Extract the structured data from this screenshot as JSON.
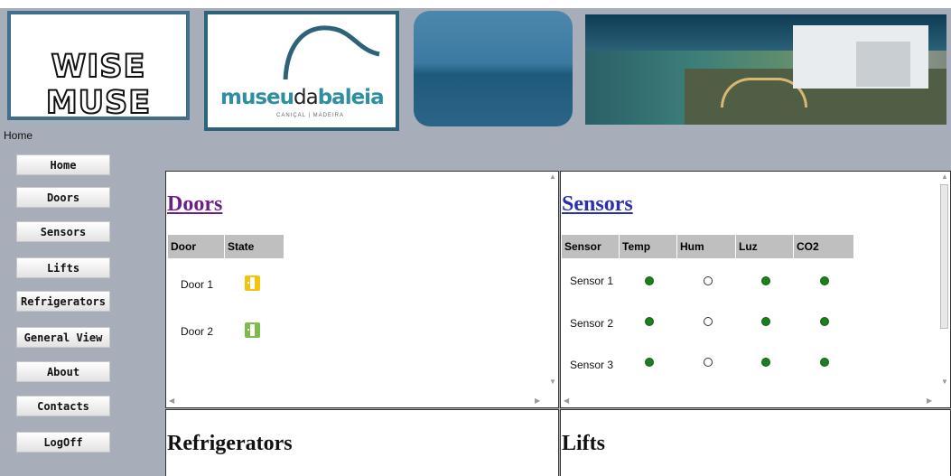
{
  "breadcrumb": "Home",
  "logos": {
    "wise_muse": "WISE MUSE",
    "museum_name_a": "museu",
    "museum_name_b": "da",
    "museum_name_c": "baleia",
    "museum_sub": "CANIÇAL | MADEIRA"
  },
  "nav": [
    {
      "label": "Home"
    },
    {
      "label": "Doors"
    },
    {
      "label": "Sensors"
    },
    {
      "label": "Lifts"
    },
    {
      "label": "Refrigerators"
    },
    {
      "label": "General View"
    },
    {
      "label": "About"
    },
    {
      "label": "Contacts"
    },
    {
      "label": "LogOff"
    }
  ],
  "doors_panel": {
    "title": "Doors",
    "headers": [
      "Door",
      "State"
    ],
    "rows": [
      {
        "name": "Door 1",
        "state_icon": "door-icon-yellow",
        "color": "#f2c40f"
      },
      {
        "name": "Door 2",
        "state_icon": "door-icon-green",
        "color": "#7dbb4a"
      }
    ]
  },
  "sensors_panel": {
    "title": "Sensors",
    "headers": [
      "Sensor",
      "Temp",
      "Hum",
      "Luz",
      "CO2"
    ],
    "rows": [
      {
        "name": "Sensor 1",
        "temp": "on",
        "hum": "off",
        "luz": "on",
        "co2": "on"
      },
      {
        "name": "Sensor 2",
        "temp": "on",
        "hum": "off",
        "luz": "on",
        "co2": "on"
      },
      {
        "name": "Sensor 3",
        "temp": "on",
        "hum": "off",
        "luz": "on",
        "co2": "on"
      }
    ]
  },
  "refrigerators_panel": {
    "title": "Refrigerators"
  },
  "lifts_panel": {
    "title": "Lifts"
  },
  "colors": {
    "background": "#a7aeb9",
    "status_on": "#1e7d1e",
    "status_off": "#ffffff"
  }
}
